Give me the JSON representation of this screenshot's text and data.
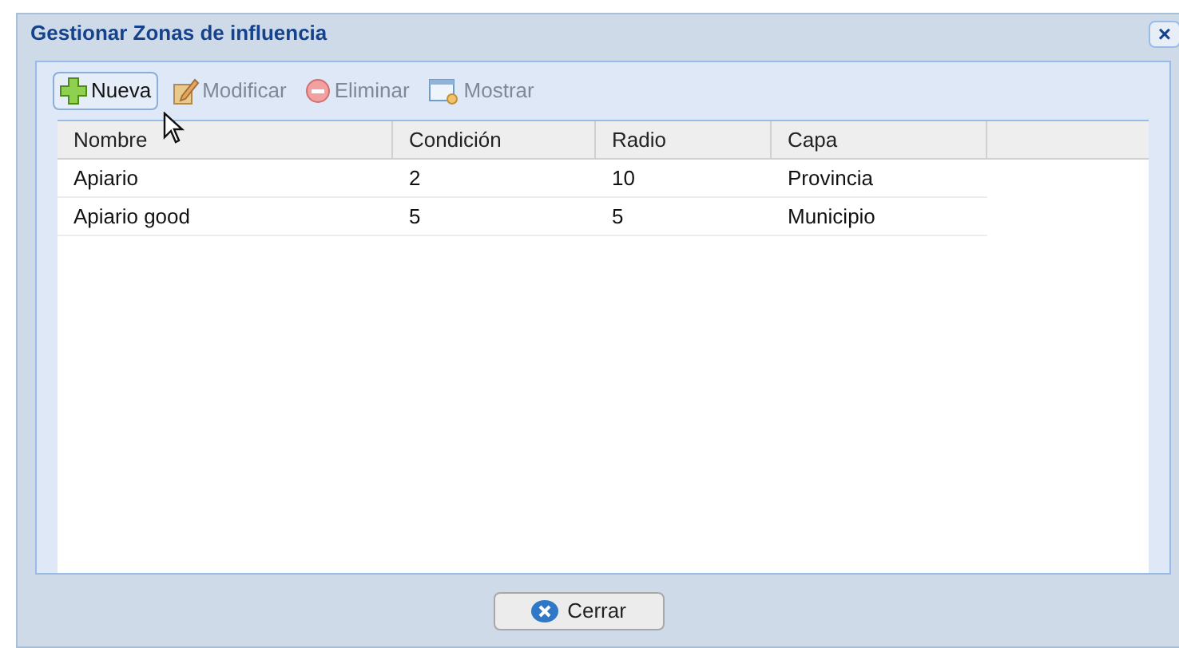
{
  "window": {
    "title": "Gestionar Zonas de influencia",
    "close": "×"
  },
  "toolbar": [
    {
      "kind": "add",
      "label": "Nueva",
      "disabled": false,
      "hovered": true
    },
    {
      "kind": "edit",
      "label": "Modificar",
      "disabled": true,
      "hovered": false
    },
    {
      "kind": "delete",
      "label": "Eliminar",
      "disabled": true,
      "hovered": false
    },
    {
      "kind": "show",
      "label": "Mostrar",
      "disabled": true,
      "hovered": false
    }
  ],
  "table": {
    "columns": [
      "Nombre",
      "Condición",
      "Radio",
      "Capa"
    ],
    "rows": [
      [
        "Apiario",
        "2",
        "10",
        "Provincia"
      ],
      [
        "Apiario good",
        "5",
        "5",
        "Municipio"
      ]
    ]
  },
  "buttons": [
    {
      "kind": "close",
      "label": "Cerrar"
    }
  ]
}
